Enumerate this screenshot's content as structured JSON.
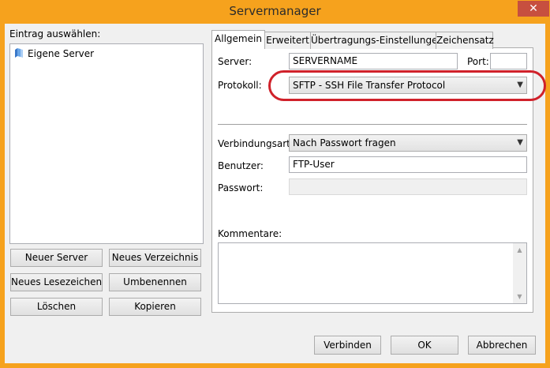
{
  "window": {
    "title": "Servermanager",
    "close_glyph": "✕"
  },
  "left": {
    "select_label": "Eintrag auswählen:",
    "tree_items": [
      {
        "label": "Eigene Server",
        "icon": "folder-icon"
      }
    ],
    "buttons": {
      "new_server": "Neuer Server",
      "new_folder": "Neues Verzeichnis",
      "new_bookmark": "Neues Lesezeichen",
      "rename": "Umbenennen",
      "delete": "Löschen",
      "copy": "Kopieren"
    }
  },
  "tabs": [
    "Allgemein",
    "Erweitert",
    "Übertragungs-Einstellungen",
    "Zeichensatz"
  ],
  "general": {
    "server_label": "Server:",
    "server_value": "SERVERNAME",
    "port_label": "Port:",
    "port_value": "",
    "protocol_label": "Protokoll:",
    "protocol_value": "SFTP - SSH File Transfer Protocol",
    "logon_label": "Verbindungsart:",
    "logon_value": "Nach Passwort fragen",
    "user_label": "Benutzer:",
    "user_value": "FTP-User",
    "password_label": "Passwort:",
    "password_value": "",
    "comments_label": "Kommentare:"
  },
  "footer": {
    "connect": "Verbinden",
    "ok": "OK",
    "cancel": "Abbrechen"
  },
  "colors": {
    "titlebar": "#f6a21d",
    "close": "#c74f3f",
    "highlight": "#d0212a"
  }
}
